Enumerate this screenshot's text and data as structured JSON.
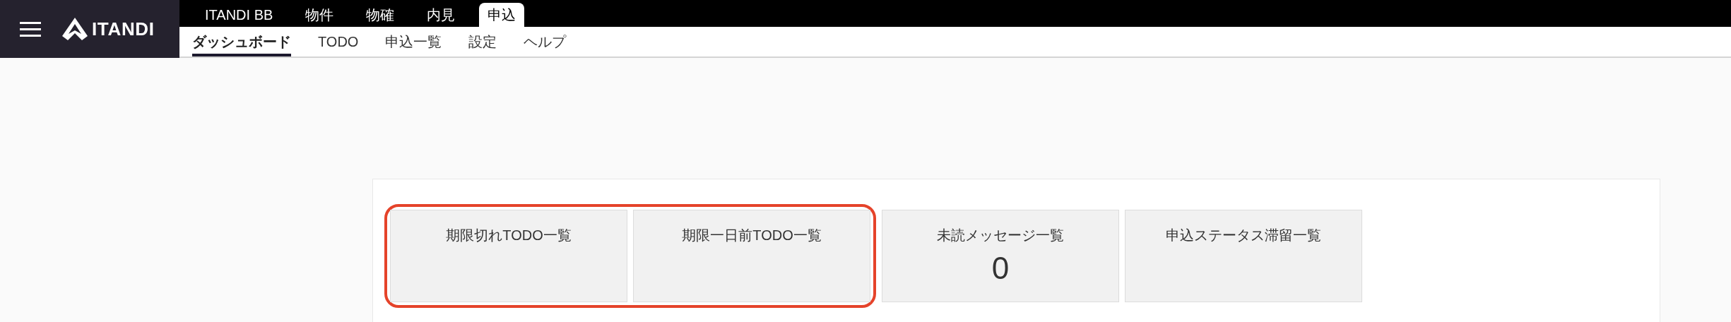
{
  "header": {
    "logo": "ITANDI"
  },
  "app_tabs": [
    {
      "label": "ITANDI BB",
      "selected": false
    },
    {
      "label": "物件",
      "selected": false
    },
    {
      "label": "物確",
      "selected": false
    },
    {
      "label": "内見",
      "selected": false
    },
    {
      "label": "申込",
      "selected": true
    }
  ],
  "sub_nav": [
    {
      "label": "ダッシュボード",
      "selected": true
    },
    {
      "label": "TODO",
      "selected": false
    },
    {
      "label": "申込一覧",
      "selected": false
    },
    {
      "label": "設定",
      "selected": false
    },
    {
      "label": "ヘルプ",
      "selected": false
    }
  ],
  "cards": [
    {
      "title": "期限切れTODO一覧",
      "highlighted": true
    },
    {
      "title": "期限一日前TODO一覧",
      "highlighted": true
    },
    {
      "title": "未読メッセージ一覧",
      "count": "0",
      "highlighted": false
    },
    {
      "title": "申込ステータス滞留一覧",
      "highlighted": false
    }
  ]
}
